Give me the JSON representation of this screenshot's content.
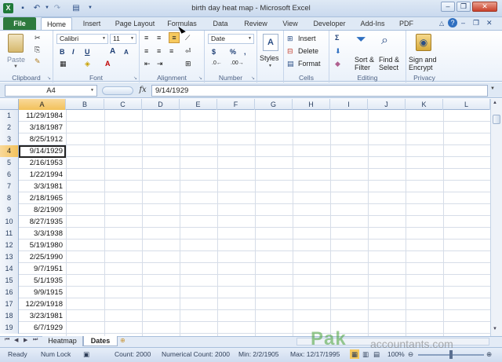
{
  "window": {
    "title": "birth day heat map - Microsoft Excel"
  },
  "quick_access": [
    "save-icon",
    "undo-icon",
    "redo-icon",
    "customize-icon"
  ],
  "tabs": [
    "File",
    "Home",
    "Insert",
    "Page Layout",
    "Formulas",
    "Data",
    "Review",
    "View",
    "Developer",
    "Add-Ins",
    "PDF"
  ],
  "ribbon": {
    "clipboard": {
      "paste": "Paste",
      "label": "Clipboard"
    },
    "font": {
      "name": "Calibri",
      "size": "11",
      "bold": "B",
      "italic": "I",
      "underline": "U",
      "grow": "A",
      "shrink": "A",
      "color": "A",
      "label": "Font"
    },
    "alignment": {
      "label": "Alignment"
    },
    "number": {
      "format": "Date",
      "currency": "$",
      "percent": "%",
      "comma": ",",
      "label": "Number"
    },
    "styles": {
      "styles": "Styles"
    },
    "cells": {
      "insert": "Insert",
      "delete": "Delete",
      "format": "Format",
      "label": "Cells"
    },
    "editing": {
      "sort": "Sort &",
      "filter": "Filter",
      "find": "Find &",
      "select": "Select",
      "label": "Editing"
    },
    "privacy": {
      "sign": "Sign and",
      "encrypt": "Encrypt",
      "label": "Privacy"
    }
  },
  "formula_bar": {
    "name_box": "A4",
    "fx": "fx",
    "value": "9/14/1929"
  },
  "columns": [
    "A",
    "B",
    "C",
    "D",
    "E",
    "F",
    "G",
    "H",
    "I",
    "J",
    "K",
    "L"
  ],
  "rows": [
    {
      "num": "1",
      "A": "11/29/1984"
    },
    {
      "num": "2",
      "A": "3/18/1987"
    },
    {
      "num": "3",
      "A": "8/25/1912"
    },
    {
      "num": "4",
      "A": "9/14/1929"
    },
    {
      "num": "5",
      "A": "2/16/1953"
    },
    {
      "num": "6",
      "A": "1/22/1994"
    },
    {
      "num": "7",
      "A": "3/3/1981"
    },
    {
      "num": "8",
      "A": "2/18/1965"
    },
    {
      "num": "9",
      "A": "8/2/1909"
    },
    {
      "num": "10",
      "A": "8/27/1935"
    },
    {
      "num": "11",
      "A": "3/3/1938"
    },
    {
      "num": "12",
      "A": "5/19/1980"
    },
    {
      "num": "13",
      "A": "2/25/1990"
    },
    {
      "num": "14",
      "A": "9/7/1951"
    },
    {
      "num": "15",
      "A": "5/1/1935"
    },
    {
      "num": "16",
      "A": "9/9/1915"
    },
    {
      "num": "17",
      "A": "12/29/1918"
    },
    {
      "num": "18",
      "A": "3/23/1981"
    },
    {
      "num": "19",
      "A": "6/7/1929"
    }
  ],
  "sheets": [
    {
      "name": "Heatmap"
    },
    {
      "name": "Dates",
      "active": true
    }
  ],
  "status": {
    "ready": "Ready",
    "numlock": "Num Lock",
    "count": "Count: 2000",
    "numerical_count": "Numerical Count: 2000",
    "min": "Min: 2/2/1905",
    "max": "Max: 12/17/1995",
    "zoom": "100%"
  },
  "watermark": {
    "logo": "Pak",
    "site": "accountants.com"
  },
  "colors": {
    "file_tab": "#2d7a3d",
    "selection": "#f2c15a",
    "accent": "#2c4f86"
  }
}
